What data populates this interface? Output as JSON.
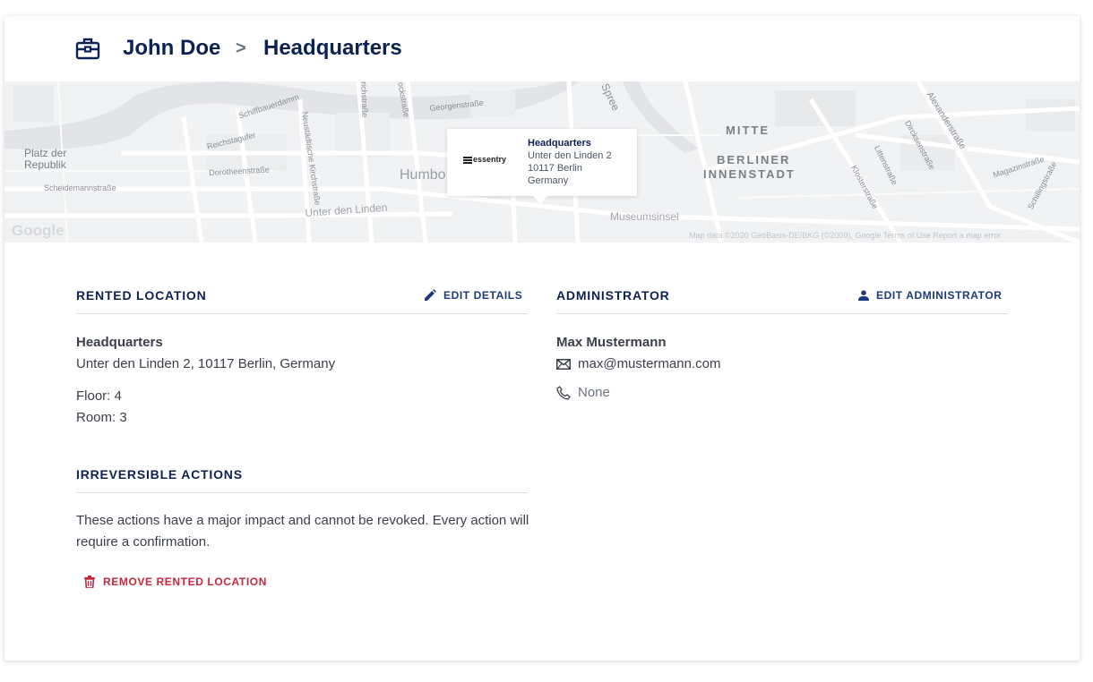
{
  "breadcrumb": {
    "parent": "John Doe",
    "separator": ">",
    "current": "Headquarters"
  },
  "map": {
    "labels": {
      "platz": "Platz der",
      "republik": "Republik",
      "schiffbauerdamm": "Schiffbauerdamm",
      "reichstagufer": "Reichstagufer",
      "dorotheenstrasse": "Dorotheenstraße",
      "scheidemannstrasse": "Scheidemannstraße",
      "neustaedtische": "Neustädtische Kirchstraße",
      "friedrichstrasse": "richstraße",
      "georgenstrasse": "Georgenstraße",
      "ockstrasse": "ockstraße",
      "spree": "Spree",
      "humbo": "Humbo",
      "unter_den_linden": "Unter den Linden",
      "museumsinsel": "Museumsinsel",
      "mitte": "MITTE",
      "berliner": "BERLINER",
      "innenstadt": "INNENSTADT",
      "alexanderstrasse": "Alexanderstraße",
      "dircksenstrasse": "Dircksenstraße",
      "littenstrasse": "Littenstraße",
      "klosterstrasse": "Klosterstraße",
      "magazinstrasse": "Magazinstraße",
      "schillingstrasse": "Schillingstraße",
      "google": "Google",
      "footer": "Map data ©2020 GeoBasis-DE/BKG (©2009), Google    Terms of Use    Report a map error"
    },
    "popup": {
      "logo": "essentry",
      "title": "Headquarters",
      "line1": "Unter den Linden 2",
      "line2": "10117 Berlin",
      "line3": "Germany"
    }
  },
  "rented_location": {
    "title": "RENTED LOCATION",
    "edit_label": "EDIT DETAILS",
    "name": "Headquarters",
    "address": "Unter den Linden 2, 10117 Berlin, Germany",
    "floor": "Floor: 4",
    "room": "Room: 3"
  },
  "administrator": {
    "title": "ADMINISTRATOR",
    "edit_label": "EDIT ADMINISTRATOR",
    "name": "Max Mustermann",
    "email": "max@mustermann.com",
    "phone": "None"
  },
  "irreversible": {
    "title": "IRREVERSIBLE ACTIONS",
    "description": "These actions have a major impact and cannot be revoked. Every action will require a confirmation.",
    "remove_label": "REMOVE RENTED LOCATION"
  },
  "colors": {
    "primary": "#0c2252",
    "accent": "#1d3b7a",
    "danger": "#c5283d",
    "map_bg": "#f1f2f3"
  }
}
